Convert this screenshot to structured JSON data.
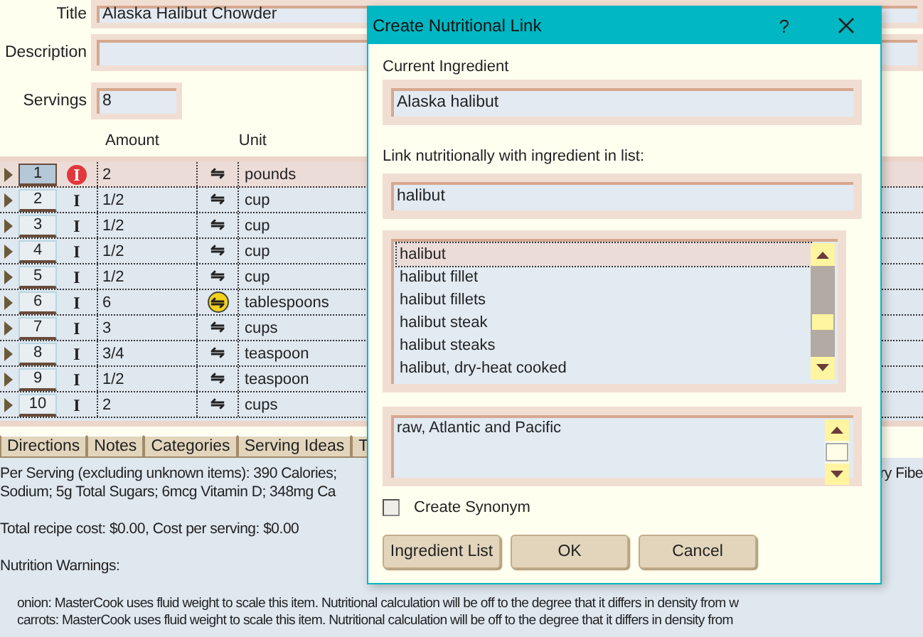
{
  "recipe": {
    "title_label": "Title",
    "title_value": "Alaska Halibut Chowder",
    "description_label": "Description",
    "servings_label": "Servings",
    "servings_value": "8"
  },
  "grid": {
    "columns": [
      "Amount",
      "Unit"
    ],
    "rows": [
      {
        "number": "1",
        "type_mark": "I",
        "alert": true,
        "amount": "2",
        "link_mark": "⇋",
        "highlighted": false,
        "unit": "pounds",
        "selected": true
      },
      {
        "number": "2",
        "type_mark": "I",
        "alert": false,
        "amount": "1/2",
        "link_mark": "⇋",
        "highlighted": false,
        "unit": "cup",
        "selected": false
      },
      {
        "number": "3",
        "type_mark": "I",
        "alert": false,
        "amount": "1/2",
        "link_mark": "⇋",
        "highlighted": false,
        "unit": "cup",
        "selected": false
      },
      {
        "number": "4",
        "type_mark": "I",
        "alert": false,
        "amount": "1/2",
        "link_mark": "⇋",
        "highlighted": false,
        "unit": "cup",
        "selected": false
      },
      {
        "number": "5",
        "type_mark": "I",
        "alert": false,
        "amount": "1/2",
        "link_mark": "⇋",
        "highlighted": false,
        "unit": "cup",
        "selected": false
      },
      {
        "number": "6",
        "type_mark": "I",
        "alert": false,
        "amount": "6",
        "link_mark": "⇋",
        "highlighted": true,
        "unit": "tablespoons",
        "selected": false
      },
      {
        "number": "7",
        "type_mark": "I",
        "alert": false,
        "amount": "3",
        "link_mark": "⇋",
        "highlighted": false,
        "unit": "cups",
        "selected": false
      },
      {
        "number": "8",
        "type_mark": "I",
        "alert": false,
        "amount": "3/4",
        "link_mark": "⇋",
        "highlighted": false,
        "unit": "teaspoon",
        "selected": false
      },
      {
        "number": "9",
        "type_mark": "I",
        "alert": false,
        "amount": "1/2",
        "link_mark": "⇋",
        "highlighted": false,
        "unit": "teaspoon",
        "selected": false
      },
      {
        "number": "10",
        "type_mark": "I",
        "alert": false,
        "amount": "2",
        "link_mark": "⇋",
        "highlighted": false,
        "unit": "cups",
        "selected": false
      }
    ]
  },
  "tabs": [
    {
      "label": "Directions",
      "selected": false
    },
    {
      "label": "Notes",
      "selected": false
    },
    {
      "label": "Categories",
      "selected": false
    },
    {
      "label": "Serving Ideas",
      "selected": false
    },
    {
      "label": "T",
      "selected": false
    }
  ],
  "info": {
    "per_serving": "Per Serving (excluding unknown items): 390 Calories;",
    "per_serving_end": "ry Fibe",
    "sodium_line": "Sodium; 5g Total Sugars; 6mcg Vitamin D; 348mg Ca",
    "cost_line": "Total recipe cost: $0.00, Cost per serving: $0.00",
    "warnings_heading": "Nutrition Warnings:",
    "warnings": [
      "onion:  MasterCook uses fluid weight to scale this item. Nutritional calculation will be off to the degree that it differs in density from w",
      "carrots:  MasterCook uses fluid weight to scale this item. Nutritional calculation will be off to the degree that it differs in density from"
    ]
  },
  "dialog": {
    "title": "Create Nutritional Link",
    "help": "?",
    "current_label": "Current Ingredient",
    "current_value": "Alaska halibut",
    "link_label": "Link nutritionally with ingredient in list:",
    "link_value": "halibut",
    "list_items": [
      {
        "label": "halibut",
        "selected": true
      },
      {
        "label": "halibut fillet",
        "selected": false
      },
      {
        "label": "halibut fillets",
        "selected": false
      },
      {
        "label": "halibut steak",
        "selected": false
      },
      {
        "label": "halibut steaks",
        "selected": false
      },
      {
        "label": "halibut, dry-heat cooked",
        "selected": false
      }
    ],
    "detail": "raw, Atlantic and Pacific",
    "synonym": {
      "label": "Create Synonym",
      "checked": false
    },
    "buttons": [
      "Ingredient List",
      "OK",
      "Cancel"
    ]
  }
}
